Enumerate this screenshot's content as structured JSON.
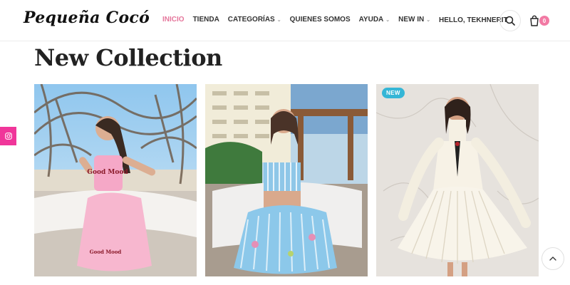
{
  "header": {
    "logo": "Pequeña Cocó",
    "nav": [
      {
        "label": "INICIO",
        "active": true,
        "dropdown": false
      },
      {
        "label": "TIENDA",
        "active": false,
        "dropdown": false
      },
      {
        "label": "CATEGORÍAS",
        "active": false,
        "dropdown": true
      },
      {
        "label": "QUIENES SOMOS",
        "active": false,
        "dropdown": false
      },
      {
        "label": "AYUDA",
        "active": false,
        "dropdown": true
      },
      {
        "label": "NEW IN",
        "active": false,
        "dropdown": true
      }
    ],
    "greeting": "HELLO, TEKHNERIT",
    "cart_count": "0",
    "icons": {
      "search": "search-icon",
      "cart": "shopping-bag-icon"
    }
  },
  "section": {
    "title": "New Collection"
  },
  "social": {
    "icon": "instagram-icon",
    "color": "#f0369a"
  },
  "products": [
    {
      "badge": "",
      "print_text": "Good Mood"
    },
    {
      "badge": "",
      "print_text": ""
    },
    {
      "badge": "NEW",
      "print_text": ""
    }
  ],
  "colors": {
    "accent": "#e5769b",
    "badge": "#35b6d6",
    "cart_badge": "#f27aa4"
  }
}
